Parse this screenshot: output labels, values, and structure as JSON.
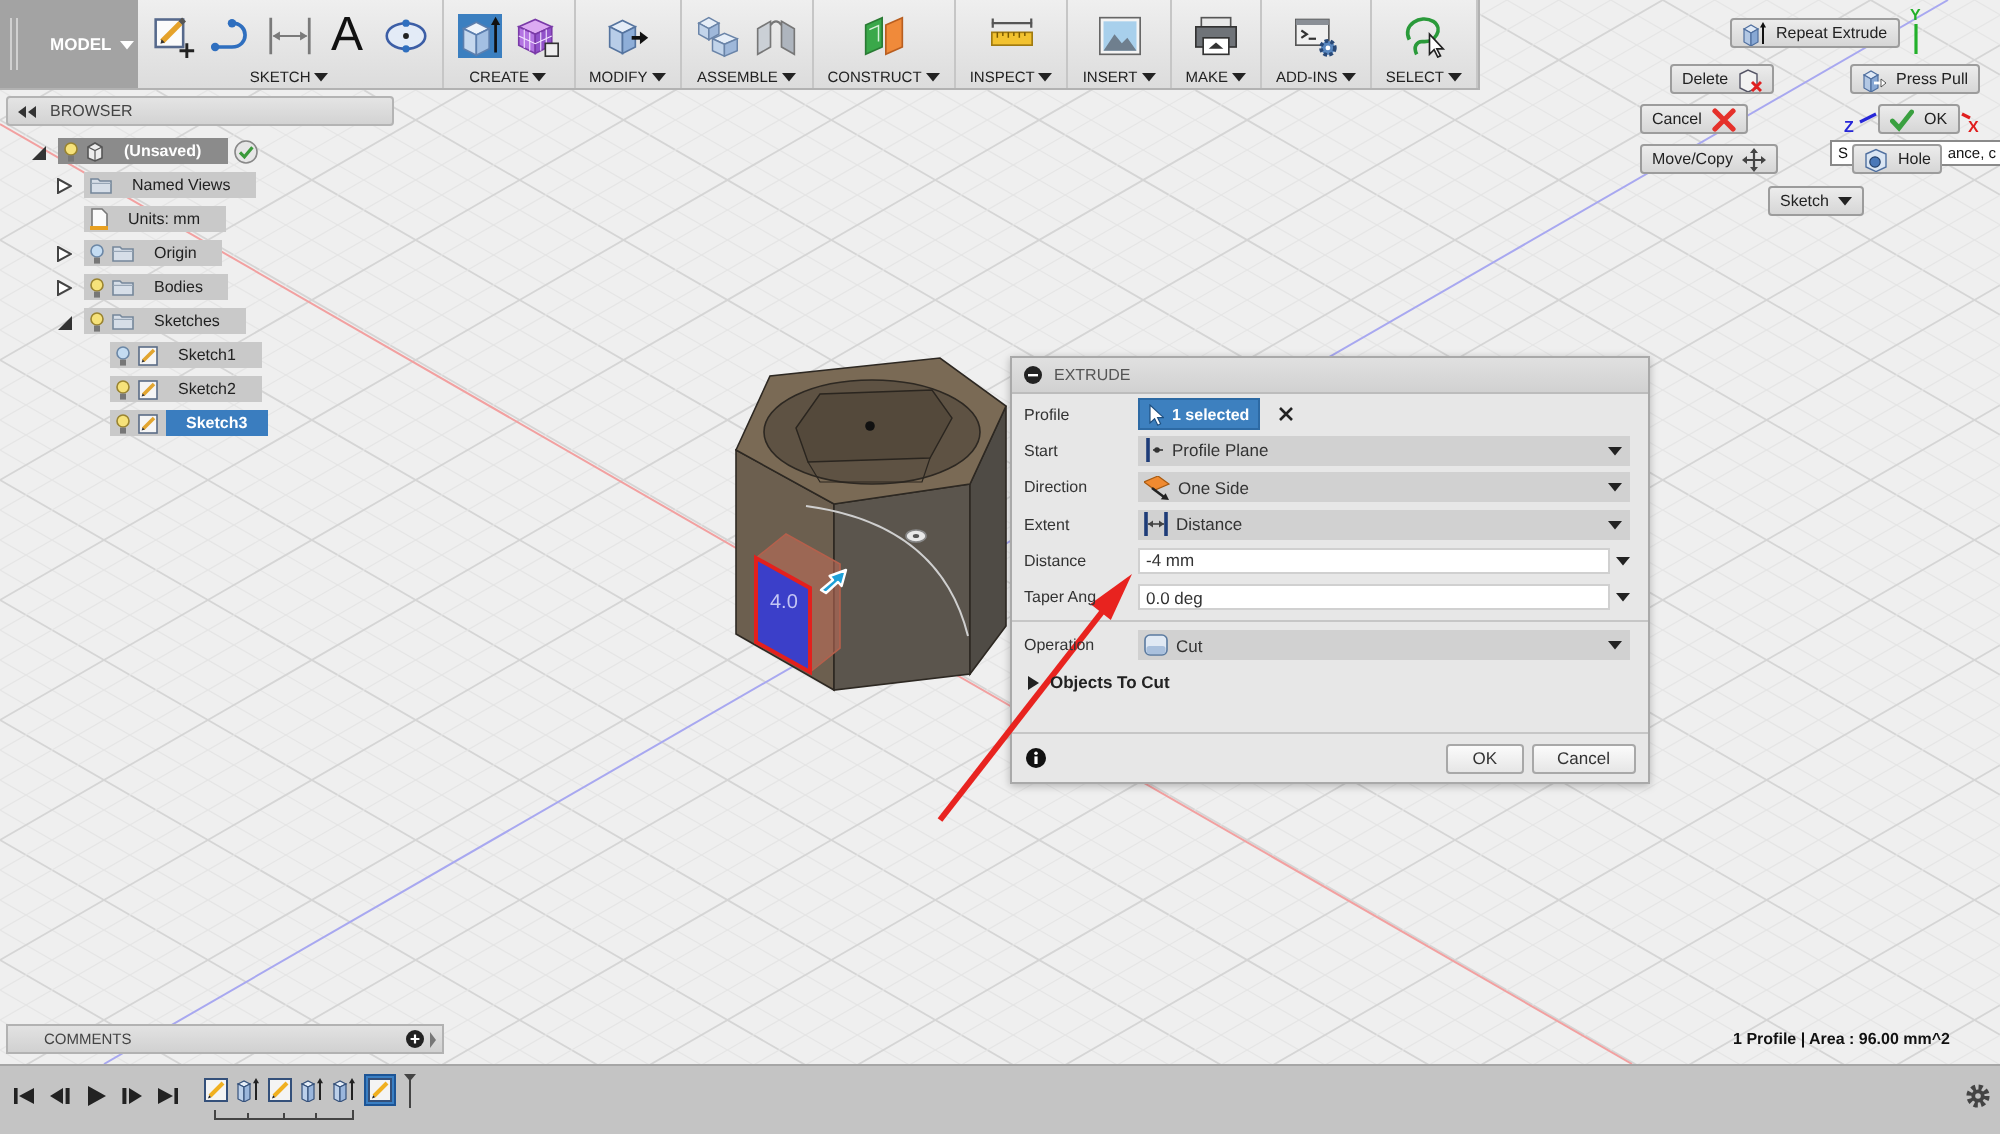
{
  "toolbar": {
    "workspace": "MODEL",
    "groups": [
      {
        "label": "SKETCH",
        "glyph": "A",
        "tools": [
          {
            "selected": false
          },
          {
            "selected": false
          },
          {
            "selected": false
          },
          {
            "selected": false
          },
          {
            "selected": false
          }
        ]
      },
      {
        "label": "CREATE",
        "tools": [
          {
            "selected": true
          },
          {
            "selected": false
          }
        ]
      },
      {
        "label": "MODIFY",
        "tools": [
          {
            "selected": false
          }
        ]
      },
      {
        "label": "ASSEMBLE",
        "tools": [
          {
            "selected": false
          },
          {
            "selected": false
          }
        ]
      },
      {
        "label": "CONSTRUCT",
        "tools": [
          {
            "selected": false
          }
        ]
      },
      {
        "label": "INSPECT",
        "tools": [
          {
            "selected": false
          }
        ]
      },
      {
        "label": "INSERT",
        "tools": [
          {
            "selected": false
          }
        ]
      },
      {
        "label": "MAKE",
        "tools": [
          {
            "selected": false
          }
        ]
      },
      {
        "label": "ADD-INS",
        "tools": [
          {
            "selected": false
          }
        ]
      },
      {
        "label": "SELECT",
        "tools": [
          {
            "selected": false
          }
        ]
      }
    ]
  },
  "browser": {
    "title": "BROWSER",
    "tree": [
      {
        "kind": "component",
        "label": "(Unsaved)",
        "expanded": true,
        "visible": true,
        "selected": false,
        "children": [
          {
            "kind": "folder",
            "label": "Named Views",
            "expanded": false,
            "selected": false
          },
          {
            "kind": "units",
            "label": "Units: mm",
            "selected": false
          },
          {
            "kind": "folder",
            "label": "Origin",
            "expanded": false,
            "visible": false,
            "selected": false
          },
          {
            "kind": "folder",
            "label": "Bodies",
            "expanded": false,
            "visible": true,
            "selected": false
          },
          {
            "kind": "folder",
            "label": "Sketches",
            "expanded": true,
            "visible": true,
            "selected": false,
            "children": [
              {
                "kind": "sketch",
                "label": "Sketch1",
                "visible": false,
                "selected": false
              },
              {
                "kind": "sketch",
                "label": "Sketch2",
                "visible": true,
                "selected": false
              },
              {
                "kind": "sketch",
                "label": "Sketch3",
                "visible": true,
                "selected": true
              }
            ]
          }
        ]
      }
    ]
  },
  "model": {
    "dimension_label": "4.0"
  },
  "extrude_dialog": {
    "title": "EXTRUDE",
    "sections": [
      {
        "rows": [
          {
            "kind": "selection",
            "label": "Profile",
            "value": "1 selected"
          },
          {
            "kind": "dropdown",
            "label": "Start",
            "value": "Profile Plane"
          },
          {
            "kind": "dropdown",
            "label": "Direction",
            "value": "One Side"
          },
          {
            "kind": "dropdown",
            "label": "Extent",
            "value": "Distance"
          },
          {
            "kind": "input",
            "label": "Distance",
            "value": "-4 mm"
          },
          {
            "kind": "input",
            "label": "Taper Ang",
            "value": "0.0 deg"
          }
        ]
      },
      {
        "rows": [
          {
            "kind": "dropdown",
            "label": "Operation",
            "value": "Cut"
          },
          {
            "kind": "group",
            "label": "Objects To Cut",
            "expanded": false
          }
        ]
      }
    ],
    "buttons": [
      "OK",
      "Cancel"
    ]
  },
  "marking_menu": {
    "hint_fragments": [
      "S",
      "ance, c"
    ],
    "buttons": [
      {
        "label": "Repeat Extrude"
      },
      {
        "label": "Delete"
      },
      {
        "label": "Press Pull"
      },
      {
        "label": "Cancel"
      },
      {
        "label": "OK"
      },
      {
        "label": "Move/Copy"
      },
      {
        "label": "Hole"
      },
      {
        "label": "Sketch"
      }
    ]
  },
  "view_cube": {
    "axes": [
      {
        "label": "Y",
        "color": "#22b02a"
      },
      {
        "label": "Z",
        "color": "#2626d8"
      },
      {
        "label": "X",
        "color": "#e01e1e"
      }
    ]
  },
  "comments": {
    "title": "COMMENTS"
  },
  "status": "1 Profile | Area : 96.00 mm^2",
  "timeline": {
    "items": [
      {
        "kind": "sketch",
        "selected": false
      },
      {
        "kind": "extrude",
        "selected": false
      },
      {
        "kind": "sketch",
        "selected": false
      },
      {
        "kind": "extrude",
        "selected": false
      },
      {
        "kind": "extrude",
        "selected": false
      },
      {
        "kind": "sketch",
        "selected": true
      }
    ]
  }
}
